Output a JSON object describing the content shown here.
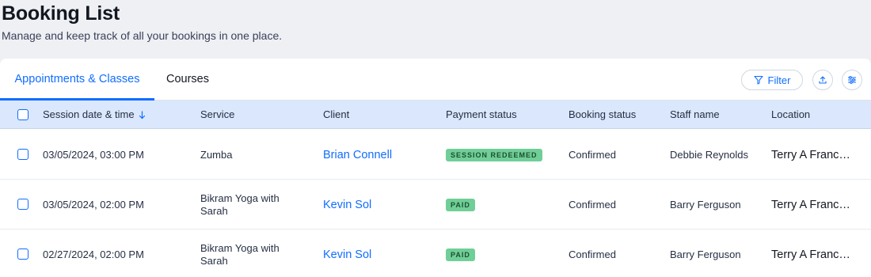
{
  "header": {
    "title": "Booking List",
    "subtitle": "Manage and keep track of all your bookings in one place."
  },
  "tabs": [
    {
      "label": "Appointments & Classes",
      "active": true
    },
    {
      "label": "Courses",
      "active": false
    }
  ],
  "toolbar": {
    "filter_label": "Filter",
    "filter_icon": "funnel-icon",
    "export_icon": "upload-icon",
    "settings_icon": "sliders-icon"
  },
  "table": {
    "columns": [
      "Session date & time",
      "Service",
      "Client",
      "Payment status",
      "Booking status",
      "Staff name",
      "Location"
    ],
    "sort_icon": "arrow-down-icon",
    "rows": [
      {
        "date": "03/05/2024, 03:00 PM",
        "service": "Zumba",
        "client": "Brian Connell",
        "payment_status": "SESSION REDEEMED",
        "booking_status": "Confirmed",
        "staff": "Debbie Reynolds",
        "location": "Terry A Franc…"
      },
      {
        "date": "03/05/2024, 02:00 PM",
        "service": "Bikram Yoga with Sarah",
        "client": "Kevin Sol",
        "payment_status": "PAID",
        "booking_status": "Confirmed",
        "staff": "Barry Ferguson",
        "location": "Terry A Franc…"
      },
      {
        "date": "02/27/2024, 02:00 PM",
        "service": "Bikram Yoga with Sarah",
        "client": "Kevin Sol",
        "payment_status": "PAID",
        "booking_status": "Confirmed",
        "staff": "Barry Ferguson",
        "location": "Terry A Franc…"
      }
    ]
  },
  "colors": {
    "accent": "#116dff",
    "header_bg": "#dae7fc",
    "badge_green": "#6fcf97"
  }
}
